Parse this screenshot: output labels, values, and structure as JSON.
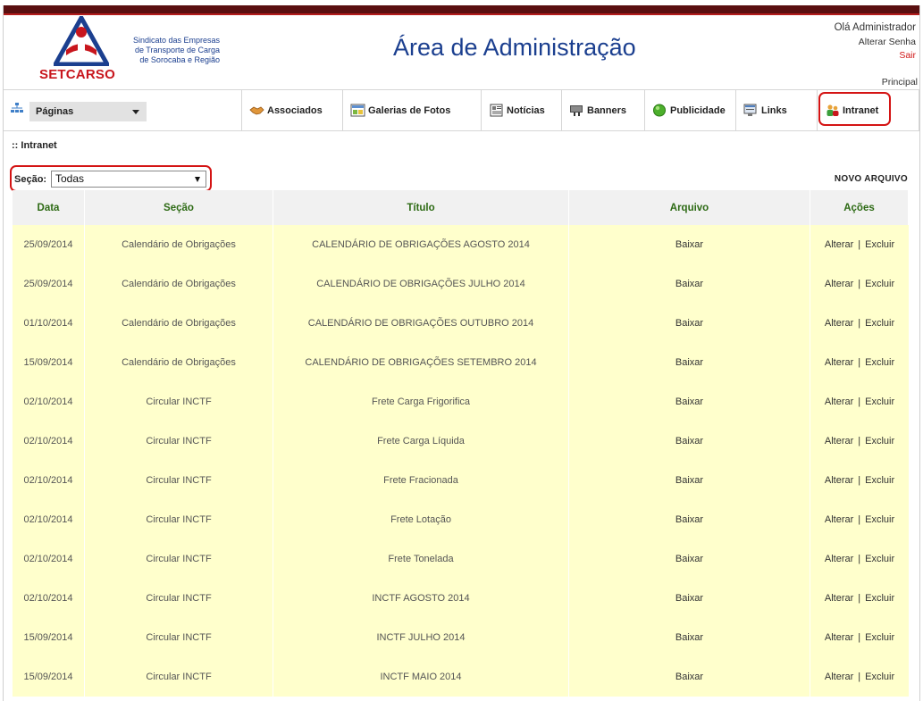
{
  "header": {
    "logo_text": "SETCARSO",
    "logo_subtitle_lines": [
      "Sindicato das Empresas",
      "de Transporte de Carga",
      "de Sorocaba e Região"
    ],
    "title": "Área de Administração",
    "greeting": "Olá Administrador",
    "change_password": "Alterar Senha",
    "logout": "Sair",
    "principal_link": "Principal"
  },
  "nav": {
    "pages_dropdown": "Páginas",
    "items": [
      {
        "label": "Associados",
        "icon": "handshake-icon"
      },
      {
        "label": "Galerias de Fotos",
        "icon": "photo-gallery-icon"
      },
      {
        "label": "Notícias",
        "icon": "news-icon"
      },
      {
        "label": "Banners",
        "icon": "banners-icon"
      },
      {
        "label": "Publicidade",
        "icon": "globe-icon"
      },
      {
        "label": "Links",
        "icon": "links-icon"
      },
      {
        "label": "Intranet",
        "icon": "intranet-users-icon"
      }
    ],
    "active": "Intranet"
  },
  "section": {
    "breadcrumb": ":: Intranet",
    "filter_label": "Seção:",
    "filter_value": "Todas",
    "new_file": "NOVO ARQUIVO"
  },
  "table": {
    "headers": [
      "Data",
      "Seção",
      "Título",
      "Arquivo",
      "Ações"
    ],
    "rows": [
      {
        "date": "25/09/2014",
        "section": "Calendário de Obrigações",
        "title": "CALENDÁRIO DE OBRIGAÇÕES AGOSTO 2014",
        "file": "Baixar",
        "edit": "Alterar",
        "delete": "Excluir"
      },
      {
        "date": "25/09/2014",
        "section": "Calendário de Obrigações",
        "title": "CALENDÁRIO DE OBRIGAÇÕES JULHO 2014",
        "file": "Baixar",
        "edit": "Alterar",
        "delete": "Excluir"
      },
      {
        "date": "01/10/2014",
        "section": "Calendário de Obrigações",
        "title": "CALENDÁRIO DE OBRIGAÇÕES OUTUBRO 2014",
        "file": "Baixar",
        "edit": "Alterar",
        "delete": "Excluir"
      },
      {
        "date": "15/09/2014",
        "section": "Calendário de Obrigações",
        "title": "CALENDÁRIO DE OBRIGAÇÕES SETEMBRO 2014",
        "file": "Baixar",
        "edit": "Alterar",
        "delete": "Excluir"
      },
      {
        "date": "02/10/2014",
        "section": "Circular INCTF",
        "title": "Frete Carga Frigorifica",
        "file": "Baixar",
        "edit": "Alterar",
        "delete": "Excluir"
      },
      {
        "date": "02/10/2014",
        "section": "Circular INCTF",
        "title": "Frete Carga Líquida",
        "file": "Baixar",
        "edit": "Alterar",
        "delete": "Excluir"
      },
      {
        "date": "02/10/2014",
        "section": "Circular INCTF",
        "title": "Frete Fracionada",
        "file": "Baixar",
        "edit": "Alterar",
        "delete": "Excluir"
      },
      {
        "date": "02/10/2014",
        "section": "Circular INCTF",
        "title": "Frete Lotação",
        "file": "Baixar",
        "edit": "Alterar",
        "delete": "Excluir"
      },
      {
        "date": "02/10/2014",
        "section": "Circular INCTF",
        "title": "Frete Tonelada",
        "file": "Baixar",
        "edit": "Alterar",
        "delete": "Excluir"
      },
      {
        "date": "02/10/2014",
        "section": "Circular INCTF",
        "title": "INCTF AGOSTO 2014",
        "file": "Baixar",
        "edit": "Alterar",
        "delete": "Excluir"
      },
      {
        "date": "15/09/2014",
        "section": "Circular INCTF",
        "title": "INCTF JULHO 2014",
        "file": "Baixar",
        "edit": "Alterar",
        "delete": "Excluir"
      },
      {
        "date": "15/09/2014",
        "section": "Circular INCTF",
        "title": "INCTF MAIO 2014",
        "file": "Baixar",
        "edit": "Alterar",
        "delete": "Excluir"
      }
    ]
  },
  "colors": {
    "accent_red": "#c8161d",
    "title_blue": "#1b3f8f",
    "header_green": "#2d6a14",
    "row_yellow": "#ffffcc",
    "highlight_red": "#d41414"
  }
}
